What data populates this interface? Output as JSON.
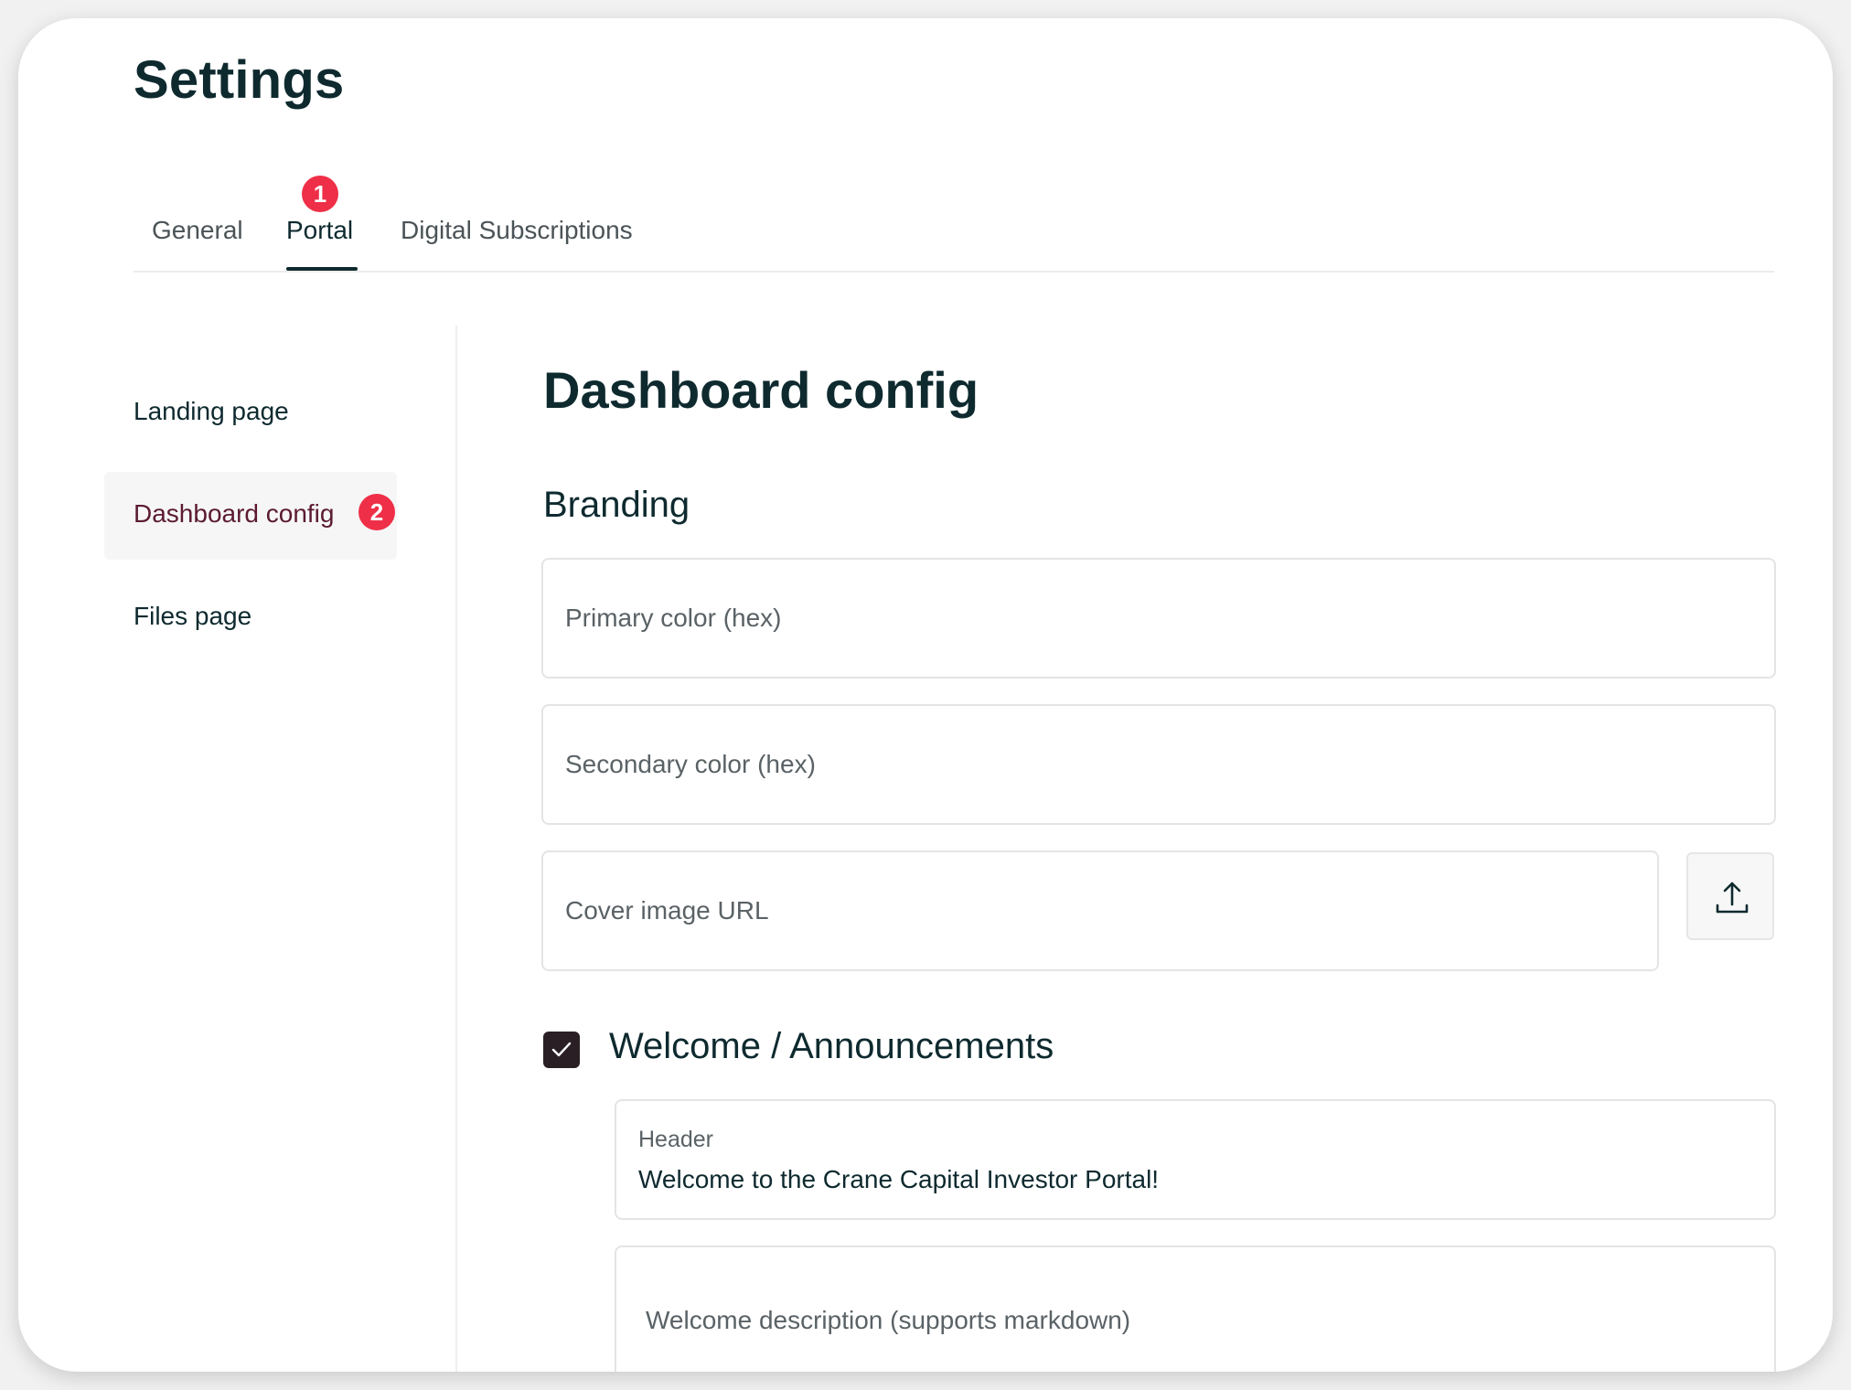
{
  "header": {
    "title": "Settings"
  },
  "tabs": [
    {
      "label": "General",
      "active": false
    },
    {
      "label": "Portal",
      "active": true,
      "badge": "1"
    },
    {
      "label": "Digital Subscriptions",
      "active": false
    }
  ],
  "sidebar": {
    "items": [
      {
        "label": "Landing page",
        "active": false
      },
      {
        "label": "Dashboard config",
        "active": true,
        "badge": "2"
      },
      {
        "label": "Files page",
        "active": false
      }
    ]
  },
  "main": {
    "title": "Dashboard config",
    "branding": {
      "title": "Branding",
      "primary_color": {
        "placeholder": "Primary color (hex)",
        "value": ""
      },
      "secondary_color": {
        "placeholder": "Secondary color (hex)",
        "value": ""
      },
      "cover_image": {
        "placeholder": "Cover image URL",
        "value": "",
        "upload_icon": "upload-icon"
      }
    },
    "welcome": {
      "title": "Welcome / Announcements",
      "checked": true,
      "header": {
        "label": "Header",
        "value": "Welcome to the Crane Capital Investor Portal!"
      },
      "description": {
        "placeholder": "Welcome description (supports markdown)",
        "value": ""
      }
    }
  },
  "colors": {
    "accent": "#0e2a2f",
    "badge": "#ef2f47",
    "active_sidebar_text": "#5b1a32",
    "checkbox": "#2a1f24"
  }
}
